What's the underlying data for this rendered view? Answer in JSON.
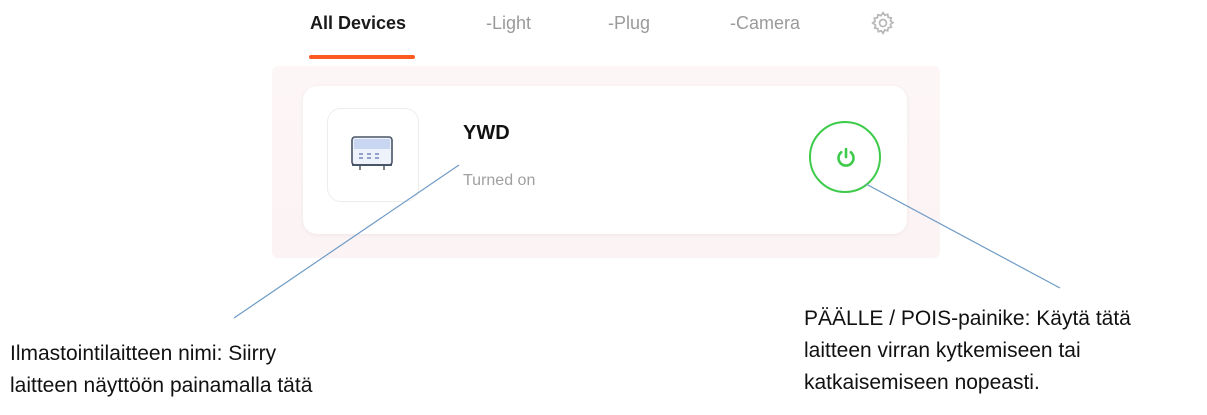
{
  "tabs": {
    "all_devices": "All Devices",
    "light": "-Light",
    "plug": "-Plug",
    "camera": "-Camera",
    "settings_icon": "gear-icon"
  },
  "device": {
    "name": "YWD",
    "status": "Turned on",
    "icon": "air-conditioner-icon",
    "power_icon": "power-icon",
    "power_color": "#3ecb4b"
  },
  "annotations": {
    "name_line1": "Ilmastointilaitteen nimi: Siirry",
    "name_line2": "laitteen näyttöön painamalla tätä",
    "power_line1": "PÄÄLLE / POIS-painike: Käytä tätä",
    "power_line2": "laitteen virran kytkemiseen tai",
    "power_line3": "katkaisemiseen nopeasti."
  },
  "colors": {
    "accent": "#ff5a1f",
    "annotation_line": "#6f9bc6"
  }
}
